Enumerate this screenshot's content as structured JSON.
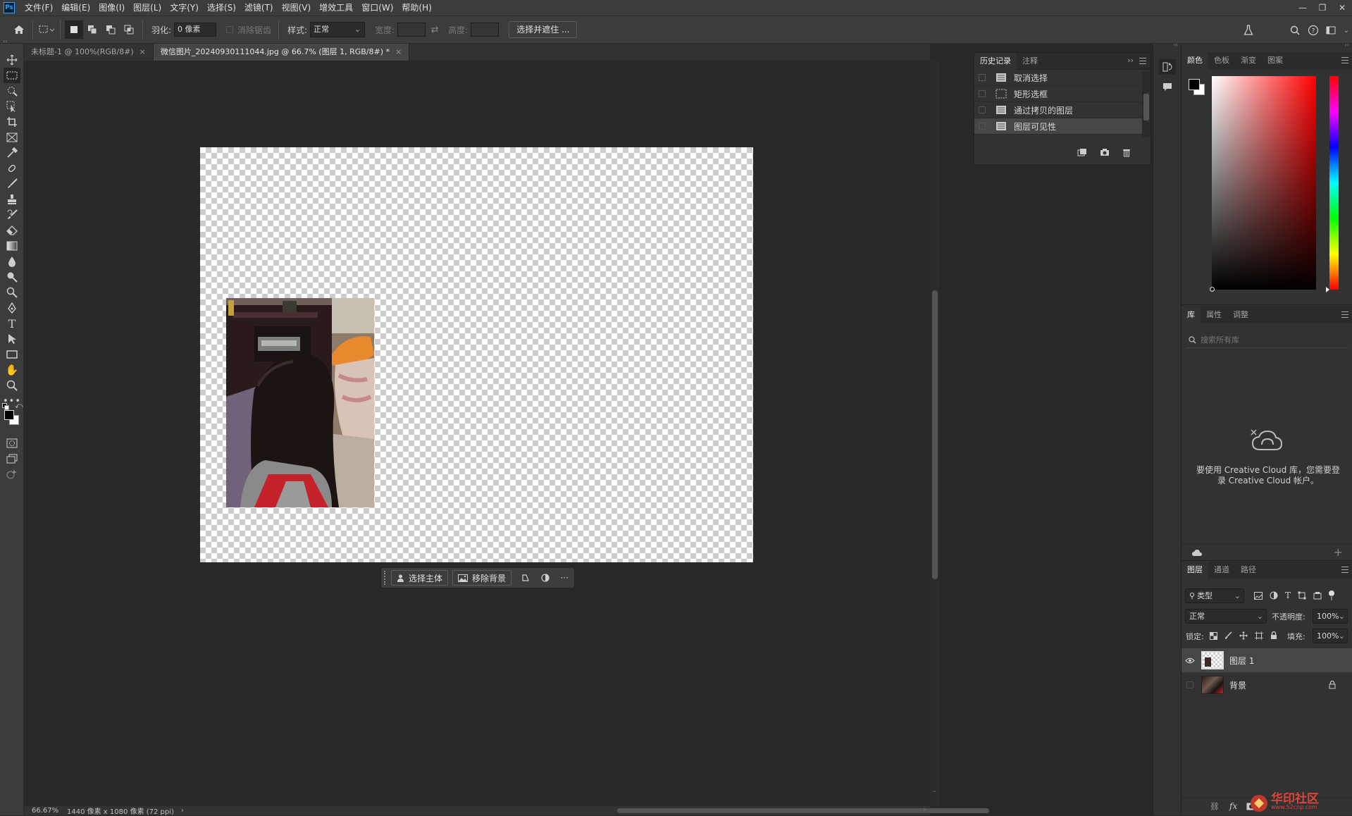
{
  "app": {
    "logo": "Ps"
  },
  "menu": [
    "文件(F)",
    "编辑(E)",
    "图像(I)",
    "图层(L)",
    "文字(Y)",
    "选择(S)",
    "滤镜(T)",
    "视图(V)",
    "增效工具",
    "窗口(W)",
    "帮助(H)"
  ],
  "options": {
    "feather_label": "羽化:",
    "feather_value": "0 像素",
    "antialias_label": "消除锯齿",
    "style_label": "样式:",
    "style_value": "正常",
    "width_label": "宽度:",
    "height_label": "高度:",
    "select_mask_button": "选择并遮住 ..."
  },
  "tabs": [
    {
      "label": "未标题-1 @ 100%(RGB/8#)",
      "close": "×"
    },
    {
      "label": "微信图片_20240930111044.jpg @ 66.7% (图层 1, RGB/8#) *",
      "close": "×"
    }
  ],
  "context_bar": {
    "select_subject": "选择主体",
    "remove_background": "移除背景",
    "more": "···"
  },
  "status": {
    "zoom": "66.67%",
    "doc_info": "1440 像素 x 1080 像素 (72 ppi)",
    "arrow": "›"
  },
  "history": {
    "tabs": [
      "历史记录",
      "注释"
    ],
    "items": [
      "取消选择",
      "矩形选框",
      "通过拷贝的图层",
      "图层可见性"
    ]
  },
  "color_panel": {
    "tabs": [
      "颜色",
      "色板",
      "渐变",
      "图案"
    ]
  },
  "library_panel": {
    "tabs": [
      "库",
      "属性",
      "调整"
    ],
    "search_placeholder": "搜索所有库",
    "message": "要使用 Creative Cloud 库，您需要登录 Creative Cloud 帐户。"
  },
  "layers_panel": {
    "tabs": [
      "图层",
      "通道",
      "路径"
    ],
    "filter_value": "类型",
    "blend_mode": "正常",
    "opacity_label": "不透明度:",
    "opacity_value": "100%",
    "lock_label": "锁定:",
    "fill_label": "填充:",
    "fill_value": "100%",
    "layers": [
      {
        "name": "图层 1",
        "visible": true
      },
      {
        "name": "背景",
        "visible": false
      }
    ],
    "footer_fx": "fx"
  },
  "watermark": "华印社区",
  "watermark_url": "www.52cnp.com",
  "colors": {
    "accent_blue": "#31a8ff",
    "ui_bg": "#3c3c3c",
    "panel_bg": "#323232",
    "workspace_bg": "#282828"
  }
}
